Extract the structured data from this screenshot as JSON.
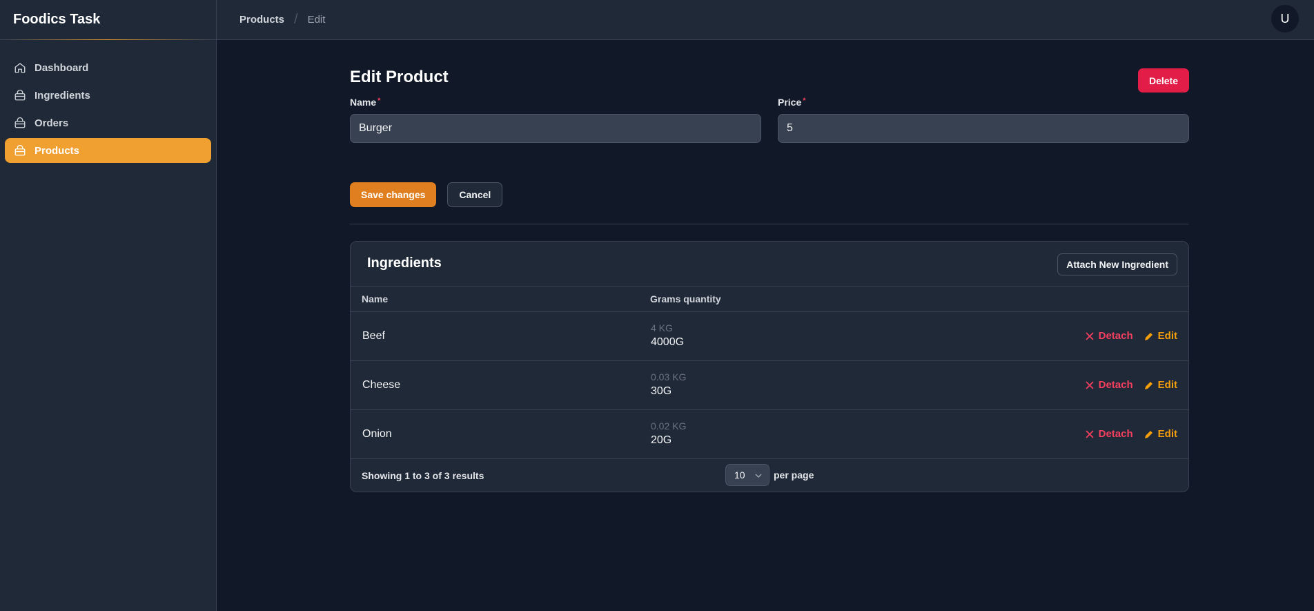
{
  "app": {
    "title": "Foodics Task",
    "avatar_initial": "U"
  },
  "sidebar": {
    "items": [
      {
        "label": "Dashboard",
        "icon": "home-icon",
        "active": false
      },
      {
        "label": "Ingredients",
        "icon": "bag-icon",
        "active": false
      },
      {
        "label": "Orders",
        "icon": "bag-icon",
        "active": false
      },
      {
        "label": "Products",
        "icon": "bag-icon",
        "active": true
      }
    ]
  },
  "breadcrumb": {
    "parent": "Products",
    "separator": "/",
    "current": "Edit"
  },
  "page": {
    "title": "Edit Product",
    "delete_label": "Delete",
    "fields": {
      "name": {
        "label": "Name",
        "required": "*",
        "value": "Burger"
      },
      "price": {
        "label": "Price",
        "required": "*",
        "value": "5"
      }
    },
    "save_label": "Save changes",
    "cancel_label": "Cancel"
  },
  "ingredients": {
    "title": "Ingredients",
    "attach_label": "Attach New Ingredient",
    "columns": {
      "name": "Name",
      "qty": "Grams quantity"
    },
    "rows": [
      {
        "name": "Beef",
        "kg": "4 KG",
        "grams": "4000G",
        "detach": "Detach",
        "edit": "Edit"
      },
      {
        "name": "Cheese",
        "kg": "0.03 KG",
        "grams": "30G",
        "detach": "Detach",
        "edit": "Edit"
      },
      {
        "name": "Onion",
        "kg": "0.02 KG",
        "grams": "20G",
        "detach": "Detach",
        "edit": "Edit"
      }
    ],
    "footer": {
      "showing": "Showing 1 to 3 of 3 results",
      "per_page_value": "10",
      "per_page_label": "per page"
    }
  },
  "colors": {
    "accent": "#f0a030",
    "danger": "#e11d48",
    "save": "#df7f1f",
    "background": "#111827",
    "panel": "#1f2937"
  }
}
